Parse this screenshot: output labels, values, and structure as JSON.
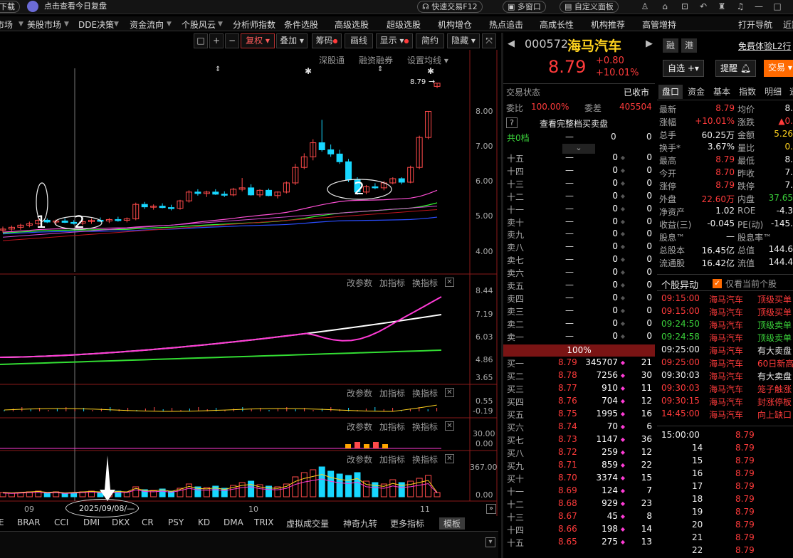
{
  "topbar": {
    "left_clip": "下载",
    "daily_review": "点击查看今日复盘",
    "quick_trade": "快速交易F12",
    "multi_window": "多窗口",
    "custom_panel": "自定义面板"
  },
  "menu": [
    "市场",
    "美股市场",
    "DDE决策",
    "资金流向",
    "个股风云",
    "分析师指数",
    "条件选股",
    "高级选股",
    "超级选股",
    "机构增仓",
    "热点追击",
    "高成长性",
    "机构推荐",
    "高管增持",
    "打开导航",
    "近期"
  ],
  "chart_toolbar": {
    "box_label": "",
    "plus": "+",
    "minus": "−",
    "adjust": "复权",
    "overlay": "叠加",
    "chips": "筹码",
    "draw": "画线",
    "display": "显示",
    "simple": "简约",
    "hide": "隐藏"
  },
  "chart_links": {
    "sgt": "深股通",
    "margin": "融资融券",
    "ma_settings": "设置均线"
  },
  "price_axis": [
    "8.00",
    "7.00",
    "6.00",
    "5.00",
    "4.00"
  ],
  "last_price_label": "8.79",
  "annotations": {
    "mark1": "1",
    "mark2a": "2",
    "mark2b": "2"
  },
  "indicator_buttons": {
    "params": "改参数",
    "add": "加指标",
    "switch": "换指标"
  },
  "ind1_axis": [
    "8.44",
    "7.19",
    "6.03",
    "4.86",
    "3.65"
  ],
  "ind2_axis": [
    "0.55",
    "-0.19"
  ],
  "ind3_axis": [
    "30.00",
    "0.00"
  ],
  "ind4_axis": [
    "367.00",
    "0.00"
  ],
  "date_axis": {
    "d09": "09",
    "d10": "10",
    "d11": "11",
    "cursor_date": "2025/09/08/—"
  },
  "indicator_tabs": [
    "E",
    "BRAR",
    "CCI",
    "DMI",
    "DKX",
    "CR",
    "PSY",
    "KD",
    "DMA",
    "TRIX",
    "虚拟成交量",
    "神奇九转",
    "更多指标",
    "模板"
  ],
  "stock": {
    "code": "000572",
    "name": "海马汽车",
    "price": "8.79",
    "change": "+0.80",
    "change_pct": "+10.01%",
    "rong": "融",
    "gang": "港",
    "l2_trial": "免费体验L2行",
    "watchlist": "自选",
    "alert": "提醒",
    "trade": "交易"
  },
  "trade_status": {
    "label": "交易状态",
    "value": "已收市"
  },
  "wei": {
    "ratio_label": "委比",
    "ratio": "100.00%",
    "diff_label": "委差",
    "diff": "405504"
  },
  "full_orderbook": "查看完整档买卖盘",
  "total_levels": {
    "label": "共0档",
    "dash": "—",
    "v1": "0",
    "v2": "0"
  },
  "sell_levels": [
    {
      "label": "十五",
      "price": "—",
      "vol": "0",
      "cnt": "0"
    },
    {
      "label": "十四",
      "price": "—",
      "vol": "0",
      "cnt": "0"
    },
    {
      "label": "十三",
      "price": "—",
      "vol": "0",
      "cnt": "0"
    },
    {
      "label": "十二",
      "price": "—",
      "vol": "0",
      "cnt": "0"
    },
    {
      "label": "十一",
      "price": "—",
      "vol": "0",
      "cnt": "0"
    },
    {
      "label": "卖十",
      "price": "—",
      "vol": "0",
      "cnt": "0"
    },
    {
      "label": "卖九",
      "price": "—",
      "vol": "0",
      "cnt": "0"
    },
    {
      "label": "卖八",
      "price": "—",
      "vol": "0",
      "cnt": "0"
    },
    {
      "label": "卖七",
      "price": "—",
      "vol": "0",
      "cnt": "0"
    },
    {
      "label": "卖六",
      "price": "—",
      "vol": "0",
      "cnt": "0"
    },
    {
      "label": "卖五",
      "price": "—",
      "vol": "0",
      "cnt": "0"
    },
    {
      "label": "卖四",
      "price": "—",
      "vol": "0",
      "cnt": "0"
    },
    {
      "label": "卖三",
      "price": "—",
      "vol": "0",
      "cnt": "0"
    },
    {
      "label": "卖二",
      "price": "—",
      "vol": "0",
      "cnt": "0"
    },
    {
      "label": "卖一",
      "price": "—",
      "vol": "0",
      "cnt": "0"
    }
  ],
  "bid_ratio_label": "100%",
  "buy_levels": [
    {
      "label": "买一",
      "price": "8.79",
      "vol": "345707",
      "cnt": "21"
    },
    {
      "label": "买二",
      "price": "8.78",
      "vol": "7256",
      "cnt": "30"
    },
    {
      "label": "买三",
      "price": "8.77",
      "vol": "910",
      "cnt": "11"
    },
    {
      "label": "买四",
      "price": "8.76",
      "vol": "704",
      "cnt": "12"
    },
    {
      "label": "买五",
      "price": "8.75",
      "vol": "1995",
      "cnt": "16"
    },
    {
      "label": "买六",
      "price": "8.74",
      "vol": "70",
      "cnt": "6"
    },
    {
      "label": "买七",
      "price": "8.73",
      "vol": "1147",
      "cnt": "36"
    },
    {
      "label": "买八",
      "price": "8.72",
      "vol": "259",
      "cnt": "12"
    },
    {
      "label": "买九",
      "price": "8.71",
      "vol": "859",
      "cnt": "22"
    },
    {
      "label": "买十",
      "price": "8.70",
      "vol": "3374",
      "cnt": "15"
    },
    {
      "label": "十一",
      "price": "8.69",
      "vol": "124",
      "cnt": "7"
    },
    {
      "label": "十二",
      "price": "8.68",
      "vol": "929",
      "cnt": "23"
    },
    {
      "label": "十三",
      "price": "8.67",
      "vol": "45",
      "cnt": "8"
    },
    {
      "label": "十四",
      "price": "8.66",
      "vol": "198",
      "cnt": "14"
    },
    {
      "label": "十五",
      "price": "8.65",
      "vol": "275",
      "cnt": "13"
    }
  ],
  "right_tabs": [
    "盘口",
    "资金",
    "基本",
    "指数",
    "明细",
    "逐"
  ],
  "fin": [
    {
      "l": "最新",
      "v": "8.79",
      "l2": "均价",
      "v2": "8."
    },
    {
      "l": "涨幅",
      "v": "+10.01%",
      "l2": "涨跌",
      "v2": "▲0."
    },
    {
      "l": "总手",
      "v": "60.25万",
      "l2": "金额",
      "v2": "5.26"
    },
    {
      "l": "换手*",
      "v": "3.67%",
      "l2": "量比",
      "v2": "0."
    },
    {
      "l": "最高",
      "v": "8.79",
      "l2": "最低",
      "v2": "8."
    },
    {
      "l": "今开",
      "v": "8.70",
      "l2": "昨收",
      "v2": "7."
    },
    {
      "l": "涨停",
      "v": "8.79",
      "l2": "跌停",
      "v2": "7."
    },
    {
      "l": "外盘",
      "v": "22.60万",
      "l2": "内盘",
      "v2": "37.65"
    },
    {
      "l": "净资产",
      "v": "1.02",
      "l2": "ROE",
      "v2": "-4.3"
    },
    {
      "l": "收益(三)",
      "v": "-0.045",
      "l2": "PE(动)",
      "v2": "-145."
    },
    {
      "l": "股息™",
      "v": "—",
      "l2": "股息率™",
      "v2": ""
    },
    {
      "l": "总股本",
      "v": "16.45亿",
      "l2": "总值",
      "v2": "144.6"
    },
    {
      "l": "流通股",
      "v": "16.42亿",
      "l2": "流值",
      "v2": "144.4"
    }
  ],
  "events_header": {
    "title": "个股异动",
    "only_current": "仅看当前个股"
  },
  "events": [
    {
      "t": "09:15:00",
      "n": "海马汽车",
      "e": "顶级买单",
      "tc": "red",
      "ec": "red"
    },
    {
      "t": "09:15:00",
      "n": "海马汽车",
      "e": "顶级买单",
      "tc": "red",
      "ec": "red"
    },
    {
      "t": "09:24:50",
      "n": "海马汽车",
      "e": "顶级卖单",
      "tc": "green",
      "ec": "green"
    },
    {
      "t": "09:24:58",
      "n": "海马汽车",
      "e": "顶级卖单",
      "tc": "green",
      "ec": "green"
    },
    {
      "t": "09:25:00",
      "n": "海马汽车",
      "e": "有大卖盘",
      "tc": "white",
      "ec": "white"
    },
    {
      "t": "09:25:00",
      "n": "海马汽车",
      "e": "60日新高",
      "tc": "red",
      "ec": "red"
    },
    {
      "t": "09:30:03",
      "n": "海马汽车",
      "e": "有大卖盘",
      "tc": "white",
      "ec": "white"
    },
    {
      "t": "09:30:03",
      "n": "海马汽车",
      "e": "笼子触涨",
      "tc": "red",
      "ec": "red"
    },
    {
      "t": "09:30:15",
      "n": "海马汽车",
      "e": "封涨停板",
      "tc": "red",
      "ec": "red"
    },
    {
      "t": "14:45:00",
      "n": "海马汽车",
      "e": "向上缺口",
      "tc": "red",
      "ec": "red"
    }
  ],
  "ticks": [
    {
      "t": "15:00:00",
      "p": "8.79"
    },
    {
      "t": "14",
      "p": "8.79"
    },
    {
      "t": "15",
      "p": "8.79"
    },
    {
      "t": "16",
      "p": "8.79"
    },
    {
      "t": "17",
      "p": "8.79"
    },
    {
      "t": "18",
      "p": "8.79"
    },
    {
      "t": "19",
      "p": "8.79"
    },
    {
      "t": "20",
      "p": "8.79"
    },
    {
      "t": "21",
      "p": "8.79"
    },
    {
      "t": "22",
      "p": "8.79"
    }
  ],
  "chart_data": {
    "type": "candlestick",
    "y_axis_ticks": [
      4.0,
      5.0,
      6.0,
      7.0,
      8.0
    ],
    "last_price": 8.79,
    "x_labels": [
      "09",
      "10",
      "11"
    ],
    "candles": [
      {
        "o": 4.62,
        "h": 4.72,
        "l": 4.55,
        "c": 4.65
      },
      {
        "o": 4.65,
        "h": 4.75,
        "l": 4.6,
        "c": 4.7
      },
      {
        "o": 4.7,
        "h": 4.8,
        "l": 4.63,
        "c": 4.76
      },
      {
        "o": 4.76,
        "h": 4.86,
        "l": 4.7,
        "c": 4.8
      },
      {
        "o": 4.8,
        "h": 4.95,
        "l": 4.75,
        "c": 4.9
      },
      {
        "o": 4.9,
        "h": 4.95,
        "l": 4.82,
        "c": 4.85
      },
      {
        "o": 4.85,
        "h": 4.92,
        "l": 4.78,
        "c": 4.88
      },
      {
        "o": 4.88,
        "h": 4.95,
        "l": 4.82,
        "c": 4.84
      },
      {
        "o": 4.84,
        "h": 4.9,
        "l": 4.78,
        "c": 4.82
      },
      {
        "o": 4.82,
        "h": 4.9,
        "l": 4.76,
        "c": 4.86
      },
      {
        "o": 4.86,
        "h": 4.95,
        "l": 4.8,
        "c": 4.9
      },
      {
        "o": 4.9,
        "h": 4.98,
        "l": 4.84,
        "c": 4.88
      },
      {
        "o": 4.88,
        "h": 4.96,
        "l": 4.82,
        "c": 4.92
      },
      {
        "o": 4.92,
        "h": 5.0,
        "l": 4.86,
        "c": 4.9
      },
      {
        "o": 4.9,
        "h": 4.98,
        "l": 4.84,
        "c": 4.94
      },
      {
        "o": 4.94,
        "h": 5.4,
        "l": 4.9,
        "c": 5.35
      },
      {
        "o": 5.35,
        "h": 5.42,
        "l": 5.22,
        "c": 5.28
      },
      {
        "o": 5.28,
        "h": 5.35,
        "l": 5.2,
        "c": 5.3
      },
      {
        "o": 5.3,
        "h": 5.38,
        "l": 5.24,
        "c": 5.26
      },
      {
        "o": 5.26,
        "h": 5.34,
        "l": 5.18,
        "c": 5.24
      },
      {
        "o": 5.24,
        "h": 5.48,
        "l": 5.2,
        "c": 5.45
      },
      {
        "o": 5.45,
        "h": 5.75,
        "l": 5.4,
        "c": 5.7
      },
      {
        "o": 5.7,
        "h": 5.78,
        "l": 5.6,
        "c": 5.66
      },
      {
        "o": 5.66,
        "h": 5.74,
        "l": 5.56,
        "c": 5.7
      },
      {
        "o": 5.7,
        "h": 5.78,
        "l": 5.62,
        "c": 5.64
      },
      {
        "o": 5.64,
        "h": 5.72,
        "l": 5.56,
        "c": 5.62
      },
      {
        "o": 5.62,
        "h": 5.82,
        "l": 5.58,
        "c": 5.78
      },
      {
        "o": 5.78,
        "h": 6.1,
        "l": 5.72,
        "c": 5.82
      },
      {
        "o": 5.82,
        "h": 5.92,
        "l": 5.6,
        "c": 5.62
      },
      {
        "o": 5.62,
        "h": 5.78,
        "l": 5.55,
        "c": 5.75
      },
      {
        "o": 5.75,
        "h": 5.8,
        "l": 5.58,
        "c": 5.6
      },
      {
        "o": 5.6,
        "h": 5.72,
        "l": 5.52,
        "c": 5.7
      },
      {
        "o": 5.7,
        "h": 6.0,
        "l": 5.66,
        "c": 5.96
      },
      {
        "o": 5.96,
        "h": 6.5,
        "l": 5.9,
        "c": 6.4
      },
      {
        "o": 6.4,
        "h": 6.8,
        "l": 6.35,
        "c": 6.7
      },
      {
        "o": 6.7,
        "h": 7.2,
        "l": 6.6,
        "c": 7.1
      },
      {
        "o": 7.1,
        "h": 7.75,
        "l": 6.85,
        "c": 6.9
      },
      {
        "o": 6.9,
        "h": 7.05,
        "l": 6.7,
        "c": 6.78
      },
      {
        "o": 6.78,
        "h": 6.9,
        "l": 6.5,
        "c": 6.56
      },
      {
        "o": 6.56,
        "h": 6.64,
        "l": 5.98,
        "c": 6.05
      },
      {
        "o": 6.05,
        "h": 6.12,
        "l": 5.62,
        "c": 5.7
      },
      {
        "o": 5.7,
        "h": 5.9,
        "l": 5.64,
        "c": 5.85
      },
      {
        "o": 5.85,
        "h": 5.95,
        "l": 5.78,
        "c": 5.82
      },
      {
        "o": 5.82,
        "h": 6.02,
        "l": 5.75,
        "c": 5.96
      },
      {
        "o": 5.96,
        "h": 6.12,
        "l": 5.92,
        "c": 6.08
      },
      {
        "o": 6.08,
        "h": 6.12,
        "l": 5.92,
        "c": 5.98
      },
      {
        "o": 5.98,
        "h": 6.45,
        "l": 5.95,
        "c": 6.4
      },
      {
        "o": 6.4,
        "h": 7.3,
        "l": 6.35,
        "c": 7.25
      },
      {
        "o": 7.25,
        "h": 8.0,
        "l": 7.2,
        "c": 7.99
      },
      {
        "o": 8.7,
        "h": 8.79,
        "l": 8.65,
        "c": 8.79
      }
    ]
  }
}
